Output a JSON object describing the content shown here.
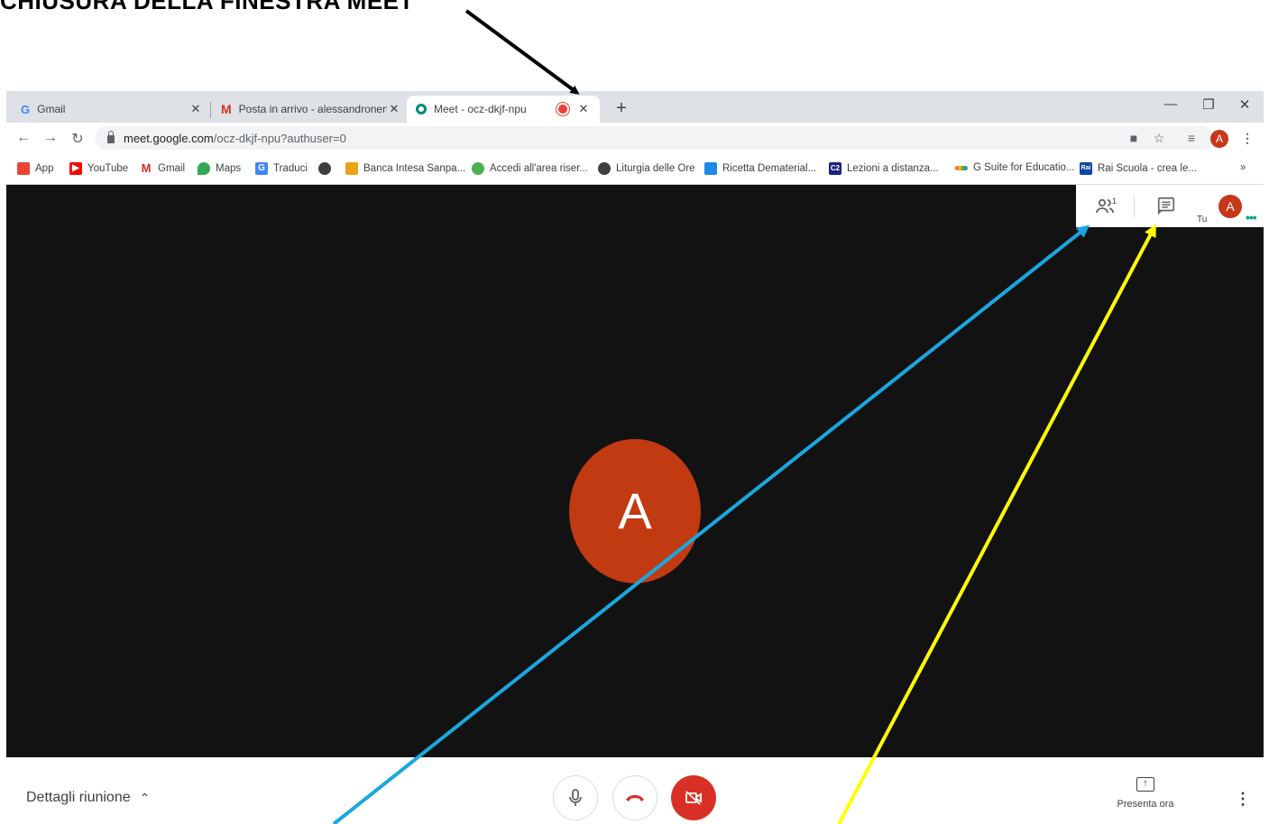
{
  "caption": "CHIUSURA DELLA FINESTRA MEET",
  "tabs": [
    {
      "title": "Gmail",
      "favicon": "google-icon"
    },
    {
      "title": "Posta in arrivo - alessandronencioni",
      "favicon": "gmail-icon"
    },
    {
      "title": "Meet - ocz-dkjf-npu",
      "favicon": "meet-icon",
      "active": true,
      "recording": true
    }
  ],
  "window": {
    "minimize": "—",
    "restore": "❐",
    "close": "✕"
  },
  "toolbar": {
    "url_host": "meet.google.com",
    "url_path": "/ocz-dkjf-npu?authuser=0",
    "profile_initial": "A"
  },
  "bookmarks": [
    {
      "label": "App",
      "icon_color": "#ea4335"
    },
    {
      "label": "YouTube",
      "icon_color": "#ff0000"
    },
    {
      "label": "Gmail",
      "icon_color": "#d93025"
    },
    {
      "label": "Maps",
      "icon_color": "#34a853"
    },
    {
      "label": "Traduci",
      "icon_color": "#4285f4"
    },
    {
      "label": "",
      "icon_color": "#3c4043"
    },
    {
      "label": "Banca Intesa Sanpa...",
      "icon_color": "#e8a317"
    },
    {
      "label": "Accedi all'area riser...",
      "icon_color": "#4caf50"
    },
    {
      "label": "Liturgia delle Ore",
      "icon_color": "#3c4043"
    },
    {
      "label": "Ricetta Dematerial...",
      "icon_color": "#1e88e5"
    },
    {
      "label": "Lezioni a distanza...",
      "icon_color": "#1a237e"
    },
    {
      "label": "G Suite for Educatio...",
      "icon_color": "#ea4335"
    },
    {
      "label": "Rai Scuola - crea le...",
      "icon_color": "#0d47a1"
    }
  ],
  "meet": {
    "participant_initial": "A",
    "participants_count": "1",
    "you_label": "Tu",
    "self_initial": "A",
    "meeting_details": "Dettagli riunione",
    "present_now": "Presenta ora"
  },
  "colors": {
    "stage_bg": "#121212",
    "avatar": "#c13a12",
    "end_call": "#d93025",
    "arrow_blue": "#1aa7e0",
    "arrow_yellow": "#ffff00",
    "arrow_black": "#000000"
  }
}
